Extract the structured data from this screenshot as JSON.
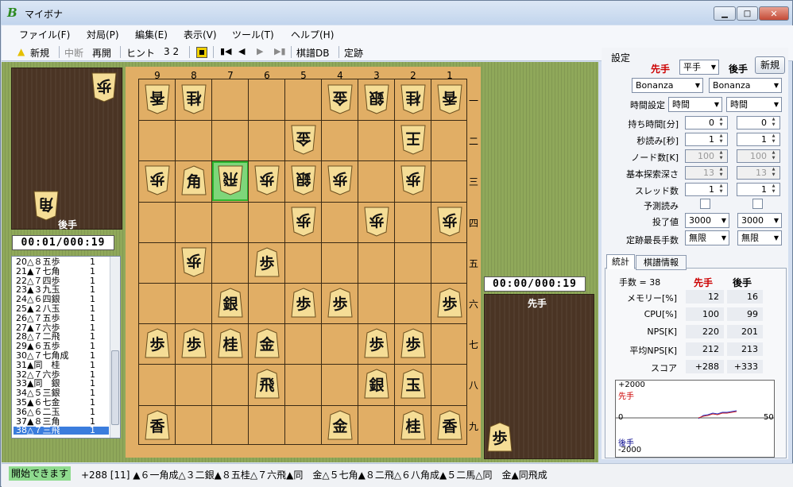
{
  "window": {
    "title": "マイボナ",
    "icon": "B",
    "controls": [
      "minimize",
      "maximize",
      "close"
    ]
  },
  "menu": [
    "ファイル(F)",
    "対局(P)",
    "編集(E)",
    "表示(V)",
    "ツール(T)",
    "ヘルプ(H)"
  ],
  "toolbar": {
    "new": "新規",
    "interrupt": "中断",
    "resume": "再開",
    "hint": "ヒント",
    "hint_value": "3 2",
    "kifu_db": "棋譜DB",
    "joseki": "定跡"
  },
  "board": {
    "files": [
      "9",
      "8",
      "7",
      "6",
      "5",
      "4",
      "3",
      "2",
      "1"
    ],
    "ranks": [
      "一",
      "二",
      "三",
      "四",
      "五",
      "六",
      "七",
      "八",
      "九"
    ],
    "pieces": [
      {
        "file": 9,
        "rank": 1,
        "kanji": "香",
        "owner": "gote"
      },
      {
        "file": 8,
        "rank": 1,
        "kanji": "桂",
        "owner": "gote"
      },
      {
        "file": 4,
        "rank": 1,
        "kanji": "金",
        "owner": "gote"
      },
      {
        "file": 3,
        "rank": 1,
        "kanji": "銀",
        "owner": "gote"
      },
      {
        "file": 2,
        "rank": 1,
        "kanji": "桂",
        "owner": "gote"
      },
      {
        "file": 1,
        "rank": 1,
        "kanji": "香",
        "owner": "gote"
      },
      {
        "file": 5,
        "rank": 2,
        "kanji": "金",
        "owner": "gote"
      },
      {
        "file": 2,
        "rank": 2,
        "kanji": "王",
        "owner": "gote"
      },
      {
        "file": 9,
        "rank": 3,
        "kanji": "歩",
        "owner": "gote"
      },
      {
        "file": 8,
        "rank": 3,
        "kanji": "角",
        "owner": "sente"
      },
      {
        "file": 7,
        "rank": 3,
        "kanji": "飛",
        "owner": "gote"
      },
      {
        "file": 6,
        "rank": 3,
        "kanji": "歩",
        "owner": "gote"
      },
      {
        "file": 5,
        "rank": 3,
        "kanji": "銀",
        "owner": "gote"
      },
      {
        "file": 4,
        "rank": 3,
        "kanji": "歩",
        "owner": "gote"
      },
      {
        "file": 2,
        "rank": 3,
        "kanji": "歩",
        "owner": "gote"
      },
      {
        "file": 5,
        "rank": 4,
        "kanji": "歩",
        "owner": "gote"
      },
      {
        "file": 3,
        "rank": 4,
        "kanji": "歩",
        "owner": "gote"
      },
      {
        "file": 1,
        "rank": 4,
        "kanji": "歩",
        "owner": "gote"
      },
      {
        "file": 8,
        "rank": 5,
        "kanji": "歩",
        "owner": "gote"
      },
      {
        "file": 6,
        "rank": 5,
        "kanji": "歩",
        "owner": "sente"
      },
      {
        "file": 7,
        "rank": 6,
        "kanji": "銀",
        "owner": "sente"
      },
      {
        "file": 5,
        "rank": 6,
        "kanji": "歩",
        "owner": "sente"
      },
      {
        "file": 4,
        "rank": 6,
        "kanji": "歩",
        "owner": "sente"
      },
      {
        "file": 1,
        "rank": 6,
        "kanji": "歩",
        "owner": "sente"
      },
      {
        "file": 9,
        "rank": 7,
        "kanji": "歩",
        "owner": "sente"
      },
      {
        "file": 8,
        "rank": 7,
        "kanji": "歩",
        "owner": "sente"
      },
      {
        "file": 7,
        "rank": 7,
        "kanji": "桂",
        "owner": "sente"
      },
      {
        "file": 6,
        "rank": 7,
        "kanji": "金",
        "owner": "sente"
      },
      {
        "file": 3,
        "rank": 7,
        "kanji": "歩",
        "owner": "sente"
      },
      {
        "file": 2,
        "rank": 7,
        "kanji": "歩",
        "owner": "sente"
      },
      {
        "file": 6,
        "rank": 8,
        "kanji": "飛",
        "owner": "sente"
      },
      {
        "file": 3,
        "rank": 8,
        "kanji": "銀",
        "owner": "sente"
      },
      {
        "file": 2,
        "rank": 8,
        "kanji": "玉",
        "owner": "sente"
      },
      {
        "file": 9,
        "rank": 9,
        "kanji": "香",
        "owner": "sente"
      },
      {
        "file": 4,
        "rank": 9,
        "kanji": "金",
        "owner": "sente"
      },
      {
        "file": 2,
        "rank": 9,
        "kanji": "桂",
        "owner": "sente"
      },
      {
        "file": 1,
        "rank": 9,
        "kanji": "香",
        "owner": "sente"
      }
    ],
    "last_move": {
      "file": 7,
      "rank": 3
    }
  },
  "gote_hand": {
    "label": "後手",
    "pieces": [
      "歩",
      "角"
    ]
  },
  "sente_hand": {
    "label": "先手",
    "pieces": [
      "歩"
    ]
  },
  "clocks": {
    "gote": "00:01/000:19",
    "sente": "00:00/000:19"
  },
  "kifu": [
    {
      "move": "20△８五歩",
      "n": "1"
    },
    {
      "move": "21▲７七角",
      "n": "1"
    },
    {
      "move": "22△７四歩",
      "n": "1"
    },
    {
      "move": "23▲３九玉",
      "n": "1"
    },
    {
      "move": "24△６四銀",
      "n": "1"
    },
    {
      "move": "25▲２八玉",
      "n": "1"
    },
    {
      "move": "26△７五歩",
      "n": "1"
    },
    {
      "move": "27▲７六歩",
      "n": "1"
    },
    {
      "move": "28△７二飛",
      "n": "1"
    },
    {
      "move": "29▲６五歩",
      "n": "1"
    },
    {
      "move": "30△７七角成",
      "n": "1"
    },
    {
      "move": "31▲同　桂",
      "n": "1"
    },
    {
      "move": "32△７六歩",
      "n": "1"
    },
    {
      "move": "33▲同　銀",
      "n": "1"
    },
    {
      "move": "34△５三銀",
      "n": "1"
    },
    {
      "move": "35▲６七金",
      "n": "1"
    },
    {
      "move": "36△６二玉",
      "n": "1"
    },
    {
      "move": "37▲８三角",
      "n": "1"
    },
    {
      "move": "38△７三飛",
      "n": "1",
      "selected": true
    }
  ],
  "settings": {
    "title": "設定",
    "sente_label": "先手",
    "gote_label": "後手",
    "handicap": "平手",
    "new_button": "新規",
    "engine_sente": "Bonanza",
    "engine_gote": "Bonanza",
    "time_setting_label": "時間設定",
    "time_sente": "時間",
    "time_gote": "時間",
    "rows": [
      {
        "label": "持ち時間[分]",
        "sente": "0",
        "gote": "0",
        "disabled": false
      },
      {
        "label": "秒読み[秒]",
        "sente": "1",
        "gote": "1",
        "disabled": false
      },
      {
        "label": "ノード数[K]",
        "sente": "100",
        "gote": "100",
        "disabled": true
      },
      {
        "label": "基本探索深さ",
        "sente": "13",
        "gote": "13",
        "disabled": true
      },
      {
        "label": "スレッド数",
        "sente": "1",
        "gote": "1",
        "disabled": false
      }
    ],
    "yosoku_label": "予測読み",
    "resign_label": "投了値",
    "resign_sente": "3000",
    "resign_gote": "3000",
    "joseki_label": "定跡最長手数",
    "joseki_sente": "無限",
    "joseki_gote": "無限"
  },
  "stats": {
    "tabs": [
      "統計",
      "棋譜情報"
    ],
    "move_count": "手数 = 38",
    "sente_label": "先手",
    "gote_label": "後手",
    "rows": [
      {
        "label": "メモリー[%]",
        "sente": "12",
        "gote": "16"
      },
      {
        "label": "CPU[%]",
        "sente": "100",
        "gote": "99"
      },
      {
        "label": "NPS[K]",
        "sente": "220",
        "gote": "201"
      },
      {
        "label": "平均NPS[K]",
        "sente": "212",
        "gote": "213"
      },
      {
        "label": "スコア",
        "sente": "+288",
        "gote": "+333"
      }
    ],
    "graph": {
      "top": "+2000",
      "bottom": "-2000",
      "zero": "0",
      "right": "50",
      "sente_label": "先手",
      "gote_label": "後手"
    }
  },
  "status": {
    "ready": "開始できます",
    "pv": "+288 [11] ▲６一角成△３二銀▲８五桂△７六飛▲同　金△５七角▲８二飛△６八角成▲５二馬△同　金▲同飛成"
  },
  "colors": {
    "sente": "#cc0000",
    "gote": "#00008b",
    "board": "#e1ae65",
    "tatami": "#8fa85a",
    "highlight": "#7ed67a",
    "selected_row": "#3b7ddd",
    "sente_eval": "#cc2222",
    "gote_eval": "#2233cc"
  }
}
